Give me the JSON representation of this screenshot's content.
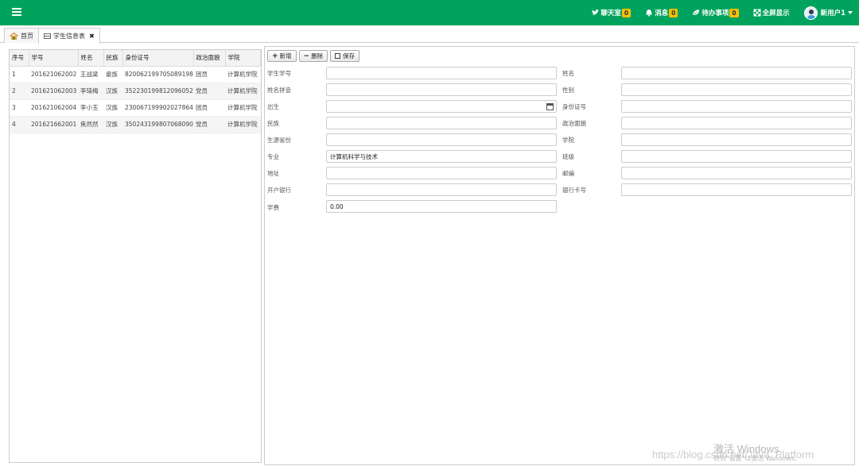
{
  "topbar": {
    "items": [
      {
        "label": "聊天室",
        "badge": "0",
        "icon": "twitter-bird-icon"
      },
      {
        "label": "消息",
        "badge": "0",
        "icon": "bell-icon"
      },
      {
        "label": "待办事项",
        "badge": "0",
        "icon": "leaf-icon"
      },
      {
        "label": "全屏显示",
        "icon": "fullscreen-icon"
      }
    ],
    "user_name": "新用户1",
    "accent_color": "#00a35d",
    "badge_color": "#f8c000"
  },
  "tabs": [
    {
      "label": "首页",
      "icon": "home-icon"
    },
    {
      "label": "学生信息表",
      "icon": "table-icon",
      "close": "✖"
    }
  ],
  "table": {
    "headers": [
      "序号",
      "学号",
      "姓名",
      "民族",
      "身份证号",
      "政治面貌",
      "学院"
    ],
    "rows": [
      [
        "1",
        "201621062002",
        "王战梁",
        "畲族",
        "820062199705089198",
        "团员",
        "计算机学院"
      ],
      [
        "2",
        "201621062003",
        "李琦梅",
        "汉族",
        "352230199812096052",
        "党员",
        "计算机学院"
      ],
      [
        "3",
        "201621062004",
        "李小玉",
        "汉族",
        "230067199902027864",
        "团员",
        "计算机学院"
      ],
      [
        "4",
        "201621662001",
        "焦然然",
        "汉族",
        "350243199807068090",
        "党员",
        "计算机学院"
      ]
    ]
  },
  "toolbar": {
    "add_label": "新增",
    "delete_label": "删除",
    "save_label": "保存"
  },
  "form": {
    "student_id_label": "学生学号",
    "student_id_value": "",
    "name_label": "姓名",
    "name_value": "",
    "pinyin_label": "姓名拼音",
    "pinyin_value": "",
    "gender_label": "性别",
    "gender_value": "",
    "birth_label": "出生",
    "birth_value": "",
    "idcard_label": "身份证号",
    "idcard_value": "",
    "ethnic_label": "民族",
    "ethnic_value": "",
    "political_label": "政治面貌",
    "political_value": "",
    "origin_label": "生源省份",
    "origin_value": "",
    "college_label": "学院",
    "college_value": "",
    "major_label": "专业",
    "major_value": "计算机科学与技术",
    "class_label": "班级",
    "class_value": "",
    "address_label": "地址",
    "address_value": "",
    "zip_label": "邮编",
    "zip_value": "",
    "bank_label": "开户银行",
    "bank_value": "",
    "card_label": "银行卡号",
    "card_value": "",
    "fee_label": "学费",
    "fee_value": "0.00"
  },
  "watermark": {
    "line1": "激活 Windows",
    "line2": "转到\"设置\"以激活 Windows。",
    "url": "https://blog.csdn.net/Java_Platform"
  }
}
